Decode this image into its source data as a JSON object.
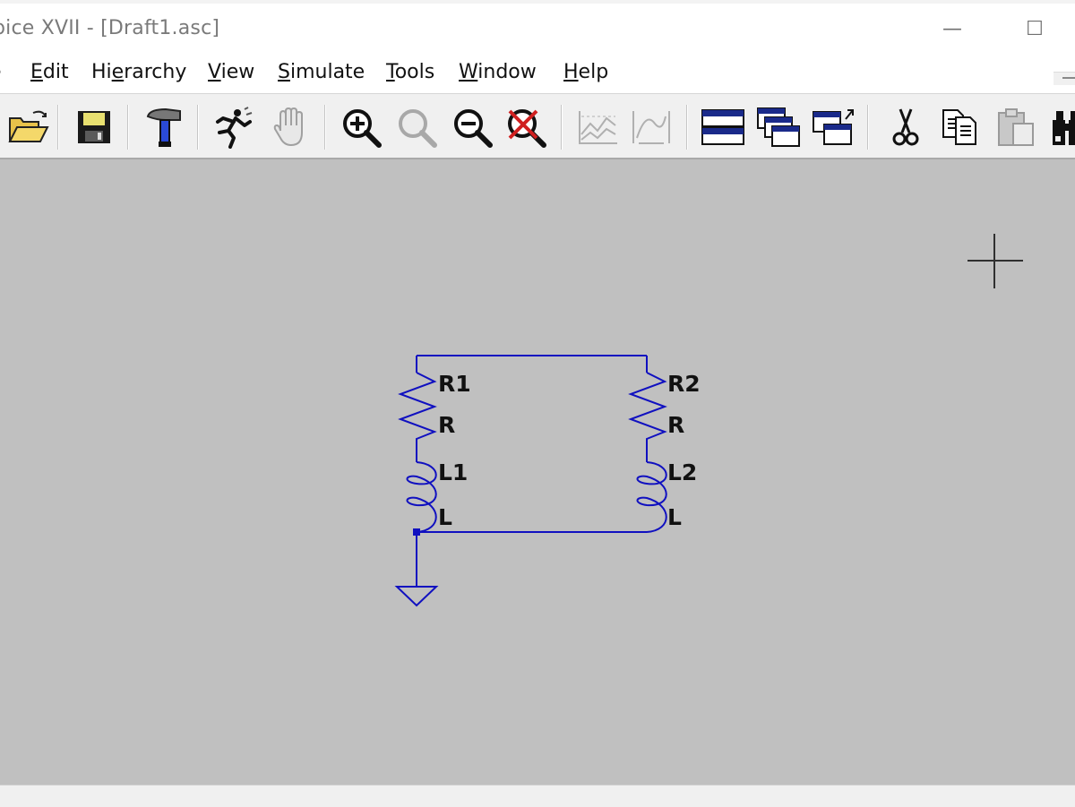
{
  "window": {
    "title": "pice XVII - [Draft1.asc]",
    "minimize_glyph": "—",
    "maximize_glyph": "☐"
  },
  "menu": {
    "items": [
      {
        "label": "e",
        "mnemonic": ""
      },
      {
        "label": "Edit",
        "mnemonic": "E"
      },
      {
        "label": "Hierarchy",
        "mnemonic": "e"
      },
      {
        "label": "View",
        "mnemonic": "V"
      },
      {
        "label": "Simulate",
        "mnemonic": "S"
      },
      {
        "label": "Tools",
        "mnemonic": "T"
      },
      {
        "label": "Window",
        "mnemonic": "W"
      },
      {
        "label": "Help",
        "mnemonic": "H"
      }
    ]
  },
  "toolbar": {
    "buttons": [
      {
        "name": "open-folder-icon",
        "enabled": true
      },
      {
        "name": "save-icon",
        "enabled": true
      },
      {
        "name": "control-panel-hammer-icon",
        "enabled": true
      },
      {
        "name": "run-icon",
        "enabled": true
      },
      {
        "name": "halt-hand-icon",
        "enabled": false
      },
      {
        "name": "zoom-in-icon",
        "enabled": true
      },
      {
        "name": "zoom-pan-icon",
        "enabled": false
      },
      {
        "name": "zoom-out-icon",
        "enabled": true
      },
      {
        "name": "zoom-fit-icon",
        "enabled": true
      },
      {
        "name": "autorange-y-icon",
        "enabled": false
      },
      {
        "name": "autorange-x-icon",
        "enabled": false
      },
      {
        "name": "tile-horizontal-icon",
        "enabled": true
      },
      {
        "name": "cascade-windows-icon",
        "enabled": true
      },
      {
        "name": "close-window-icon",
        "enabled": true
      },
      {
        "name": "cut-icon",
        "enabled": true
      },
      {
        "name": "copy-icon",
        "enabled": true
      },
      {
        "name": "paste-icon",
        "enabled": false
      },
      {
        "name": "find-binoculars-icon",
        "enabled": true
      }
    ]
  },
  "schematic": {
    "wire_color": "#1010c0",
    "background_color": "#c0c0c0",
    "components": [
      {
        "type": "resistor",
        "ref": "R1",
        "value": "R"
      },
      {
        "type": "inductor",
        "ref": "L1",
        "value": "L"
      },
      {
        "type": "resistor",
        "ref": "R2",
        "value": "R"
      },
      {
        "type": "inductor",
        "ref": "L2",
        "value": "L"
      }
    ],
    "ground": "gnd"
  }
}
